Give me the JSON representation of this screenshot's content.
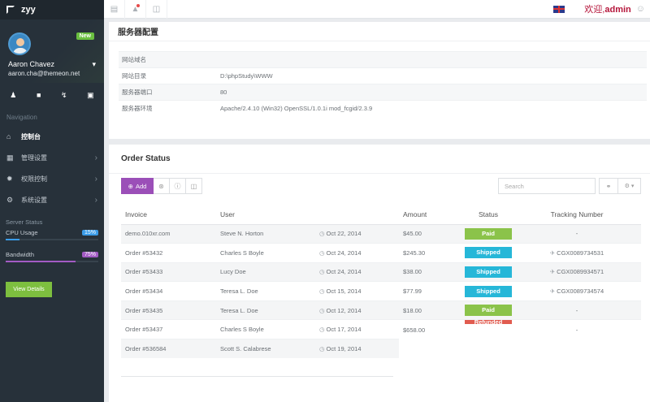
{
  "brand": {
    "name": "zyy"
  },
  "profile": {
    "badge": "New",
    "name": "Aaron Chavez",
    "email": "aaron.cha@themeon.net",
    "caret": "▾"
  },
  "nav": {
    "title": "Navigation",
    "items": [
      {
        "label": "控制台",
        "icon": "home-icon"
      },
      {
        "label": "管理设置",
        "icon": "grid-icon"
      },
      {
        "label": "权限控制",
        "icon": "gear-icon"
      },
      {
        "label": "系统设置",
        "icon": "cog-icon"
      }
    ]
  },
  "server_status": {
    "title": "Server Status",
    "cpu": {
      "label": "CPU Usage",
      "pct_label": "15%",
      "value": 15,
      "color": "#3b9ce8"
    },
    "bandwidth": {
      "label": "Bandwidth",
      "pct_label": "75%",
      "value": 75,
      "color": "#a35bc4"
    },
    "details_label": "View Details"
  },
  "topbar": {
    "welcome": "欢迎,",
    "user": "admin"
  },
  "config": {
    "title": "服务器配置",
    "rows": [
      {
        "key": "网站域名",
        "value": ""
      },
      {
        "key": "网站目录",
        "value": "D:\\phpStudy\\WWW"
      },
      {
        "key": "服务器端口",
        "value": "80"
      },
      {
        "key": "服务器环境",
        "value": "Apache/2.4.10 (Win32) OpenSSL/1.0.1i mod_fcgid/2.3.9"
      }
    ]
  },
  "orders": {
    "title": "Order Status",
    "add_label": "Add",
    "search_placeholder": "Search",
    "columns": [
      "Invoice",
      "User",
      "",
      "Amount",
      "Status",
      "Tracking Number"
    ],
    "rows": [
      {
        "invoice": "demo.010xr.com",
        "user": "Steve N. Horton",
        "date": "Oct 22, 2014",
        "amount": "$45.00",
        "status": "Paid",
        "tracking": "-"
      },
      {
        "invoice": "Order #53432",
        "user": "Charles S Boyle",
        "date": "Oct 24, 2014",
        "amount": "$245.30",
        "status": "Shipped",
        "tracking": "CGX0089734531"
      },
      {
        "invoice": "Order #53433",
        "user": "Lucy Doe",
        "date": "Oct 24, 2014",
        "amount": "$38.00",
        "status": "Shipped",
        "tracking": "CGX0089934571"
      },
      {
        "invoice": "Order #53434",
        "user": "Teresa L. Doe",
        "date": "Oct 15, 2014",
        "amount": "$77.99",
        "status": "Shipped",
        "tracking": "CGX0089734574"
      },
      {
        "invoice": "Order #53435",
        "user": "Teresa L. Doe",
        "date": "Oct 12, 2014",
        "amount": "$18.00",
        "status": "Paid",
        "tracking": "-"
      },
      {
        "invoice": "Order #53437",
        "user": "Charles S Boyle",
        "date": "Oct 17, 2014",
        "amount": "$658.00",
        "status": "Refunded",
        "tracking": "-"
      },
      {
        "invoice": "Order #536584",
        "user": "Scott S. Calabrese",
        "date": "Oct 19, 2014",
        "amount": "",
        "status": "",
        "tracking": ""
      }
    ]
  }
}
